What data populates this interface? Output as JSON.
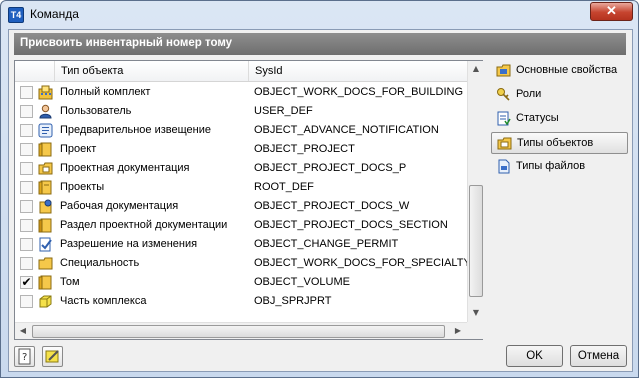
{
  "window": {
    "title": "Команда",
    "app_icon_text": "T4",
    "close_glyph": "✕"
  },
  "header": {
    "text": "Присвоить инвентарный номер тому"
  },
  "grid": {
    "columns": [
      "",
      "Тип объекта",
      "SysId"
    ],
    "rows": [
      {
        "checked": false,
        "icon": "building-complex-icon",
        "name": "Полный комплект",
        "sysid": "OBJECT_WORK_DOCS_FOR_BUILDING"
      },
      {
        "checked": false,
        "icon": "user-icon",
        "name": "Пользователь",
        "sysid": "USER_DEF"
      },
      {
        "checked": false,
        "icon": "notification-form-icon",
        "name": "Предварительное извещение",
        "sysid": "OBJECT_ADVANCE_NOTIFICATION"
      },
      {
        "checked": false,
        "icon": "project-book-icon",
        "name": "Проект",
        "sysid": "OBJECT_PROJECT"
      },
      {
        "checked": false,
        "icon": "folder-docs-icon",
        "name": "Проектная документация",
        "sysid": "OBJECT_PROJECT_DOCS_P"
      },
      {
        "checked": false,
        "icon": "projects-book-icon",
        "name": "Проекты",
        "sysid": "ROOT_DEF"
      },
      {
        "checked": false,
        "icon": "work-docs-icon",
        "name": "Рабочая документация",
        "sysid": "OBJECT_PROJECT_DOCS_W"
      },
      {
        "checked": false,
        "icon": "section-book-icon",
        "name": "Раздел проектной документации",
        "sysid": "OBJECT_PROJECT_DOCS_SECTION"
      },
      {
        "checked": false,
        "icon": "permit-check-icon",
        "name": "Разрешение на изменения",
        "sysid": "OBJECT_CHANGE_PERMIT"
      },
      {
        "checked": false,
        "icon": "specialty-folder-icon",
        "name": "Специальность",
        "sysid": "OBJECT_WORK_DOCS_FOR_SPECIALTY"
      },
      {
        "checked": true,
        "icon": "volume-book-icon",
        "name": "Том",
        "sysid": "OBJECT_VOLUME"
      },
      {
        "checked": false,
        "icon": "cube-icon",
        "name": "Часть комплекса",
        "sysid": "OBJ_SPRJPRT"
      }
    ],
    "check_glyph": "✔"
  },
  "sidebar": {
    "items": [
      {
        "label": "Основные свойства",
        "icon": "properties-folder-icon",
        "selected": false
      },
      {
        "label": "Роли",
        "icon": "roles-key-icon",
        "selected": false
      },
      {
        "label": "Статусы",
        "icon": "statuses-icon",
        "selected": false
      },
      {
        "label": "Типы объектов",
        "icon": "object-types-folder-icon",
        "selected": true
      },
      {
        "label": "Типы файлов",
        "icon": "file-types-icon",
        "selected": false
      }
    ]
  },
  "buttons": {
    "ok": "OK",
    "cancel": "Отмена"
  },
  "scroll_arrows": {
    "up": "▲",
    "down": "▼",
    "left": "◀",
    "right": "▶"
  }
}
